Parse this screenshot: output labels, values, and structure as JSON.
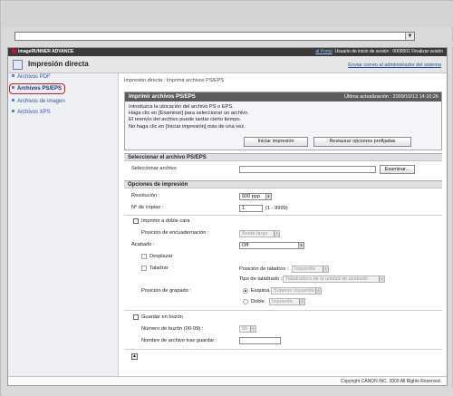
{
  "app": {
    "logo": "imageRUNNER ADVANCE",
    "portal_link": "al Portal",
    "user_info": "Usuario de inicio de sesión : 0000001 Finalizar sesión",
    "title": "Impresión directa",
    "mail_link": "Enviar correo al administrador del sistema",
    "address_dropdown": "▼"
  },
  "sidebar": {
    "items": [
      {
        "label": "Archivos PDF"
      },
      {
        "label": "Archivos PS/EPS"
      },
      {
        "label": "Archivos de imagen"
      },
      {
        "label": "Archivos XPS"
      }
    ]
  },
  "breadcrumb": {
    "root": "Impresión directa",
    "sep": ":",
    "current": "Imprimir archivos PS/EPS"
  },
  "print_panel": {
    "title": "Imprimir archivos PS/EPS",
    "last_update": "Última actualización : 2009/10/13 14:10:26",
    "lines": [
      "Introduzca la ubicación del archivo PS o EPS.",
      "Haga clic en [Examinar] para seleccionar un archivo.",
      "El reenvío del archivo puede tardar cierto tiempo.",
      "No haga clic en [Iniciar impresión] más de una vez."
    ],
    "start_button": "Iniciar impresión",
    "restore_button": "Restaurar opciones prefijadas"
  },
  "select_file": {
    "title": "Seleccionar el archivo PS/EPS",
    "label": "Seleccionar archivo",
    "value": "",
    "browse_button": "Examinar..."
  },
  "options": {
    "title": "Opciones de impresión",
    "resolution_label": "Resolución :",
    "resolution_value": "600 ppp",
    "copies_label": "Nº de copias :",
    "copies_value": "1",
    "copies_range": "(1 - 9999)",
    "duplex_label": "Imprimir a doble cara",
    "binding_label": "Posición de encuadernación :",
    "binding_value": "Borde largo",
    "finish_label": "Acabado :",
    "finish_value": "Off",
    "offset_label": "Desplazar",
    "punch_label": "Taladrar",
    "punch_pos_label": "Posición de taladros :",
    "punch_pos_value": "Izquierda",
    "punch_type_label": "Tipo de taladrado :",
    "punch_type_value": "Taladradora de la unidad de acabado",
    "staple_label": "Posición de grapado :",
    "corner_label": "Esquina",
    "corner_value": "Superior izquierda",
    "double_label": "Doble",
    "double_value": "Izquierda",
    "store_label": "Guardar en buzón",
    "box_no_label": "Número de buzón (00-99) :",
    "box_no_value": "00",
    "file_name_label": "Nombre de archivo tras guardar :",
    "file_name_value": ""
  },
  "footer": {
    "top_icon": "▲",
    "copyright": "Copyright CANON INC. 2009 All Rights Reserved."
  },
  "colors": {
    "accent": "#2b55a8",
    "header_dark": "#3a3a3a",
    "highlight": "#d01d1d"
  }
}
